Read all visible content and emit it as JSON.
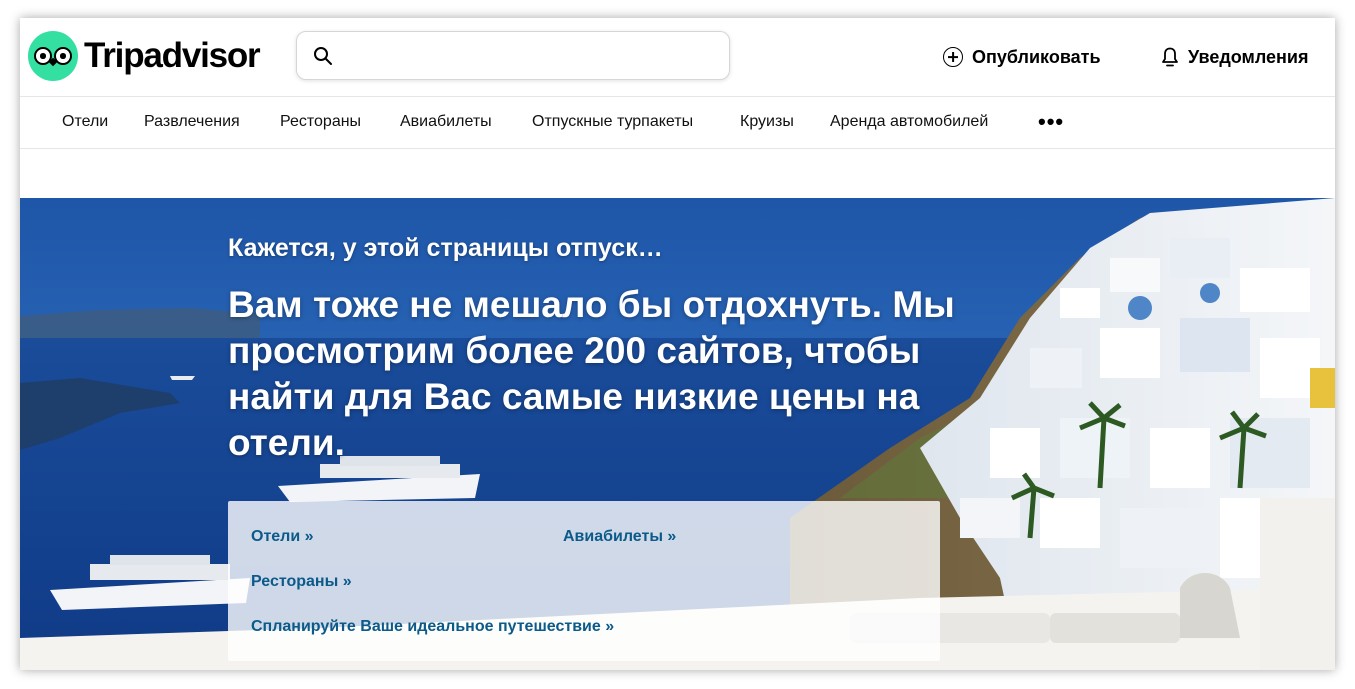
{
  "header": {
    "logo_text": "Tripadvisor",
    "search": {
      "placeholder": "",
      "value": ""
    },
    "publish_label": "Опубликовать",
    "notifications_label": "Уведомления"
  },
  "nav": {
    "items": [
      "Отели",
      "Развлечения",
      "Рестораны",
      "Авиабилеты",
      "Отпускные турпакеты",
      "Круизы",
      "Аренда автомобилей"
    ],
    "more": "•••"
  },
  "hero": {
    "kicker": "Кажется, у этой страницы отпуск…",
    "headline": "Вам тоже не мешало бы отдохнуть. Мы просмотрим более 200 сайтов, чтобы найти для Вас самые низкие цены на отели.",
    "links": {
      "hotels": "Отели »",
      "flights": "Авиабилеты »",
      "restaurants": "Рестораны »",
      "plan": "Спланируйте Ваше идеальное путешествие »"
    }
  },
  "colors": {
    "brand": "#34e0a1",
    "link": "#0b5a8a",
    "sea": "#1f4fa0"
  },
  "icons": [
    "owl-logo-icon",
    "search-icon",
    "plus-circle-icon",
    "bell-icon",
    "more-dots-icon"
  ]
}
